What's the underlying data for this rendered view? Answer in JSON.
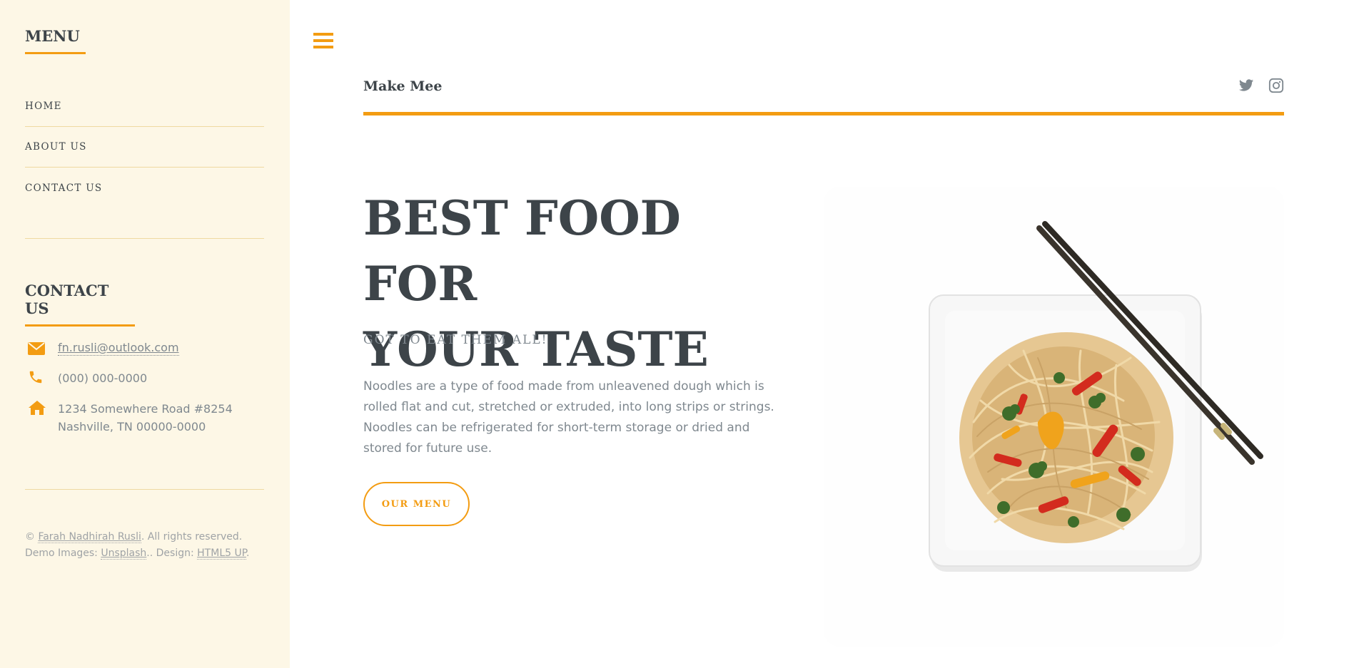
{
  "sidebar": {
    "menu_title": "MENU",
    "menu_items": [
      {
        "label": "HOME"
      },
      {
        "label": "ABOUT US"
      },
      {
        "label": "CONTACT US"
      }
    ],
    "contact_title": "CONTACT US",
    "contact": {
      "email": "fn.rusli@outlook.com",
      "phone": "(000) 000-0000",
      "address_line1": "1234 Somewhere Road #8254",
      "address_line2": "Nashville, TN 00000-0000"
    },
    "footer": {
      "copyright_prefix": "© ",
      "author": "Farah Nadhirah Rusli",
      "rights": ". All rights reserved.",
      "demo_prefix": "Demo Images: ",
      "unsplash": "Unsplash",
      "design_prefix": ".. Design: ",
      "html5up": "HTML5 UP",
      "end": "."
    }
  },
  "header": {
    "logo": "Make Mee",
    "socials": [
      "twitter-icon",
      "instagram-icon"
    ]
  },
  "hero": {
    "title_line1": "BEST FOOD FOR",
    "title_line2": "YOUR TASTE",
    "subtitle": "GOT TO EAT THEM ALL!",
    "text": "Noodles are a type of food made from unleavened dough which is rolled flat and cut, stretched or extruded, into long strips or strings. Noodles can be refrigerated for short-term storage or dried and stored for future use.",
    "button_label": "OUR MENU"
  },
  "colors": {
    "accent": "#f39c12",
    "sidebar_bg": "#fdf7e6",
    "heading": "#3d4449",
    "body_text": "#7f888f"
  }
}
